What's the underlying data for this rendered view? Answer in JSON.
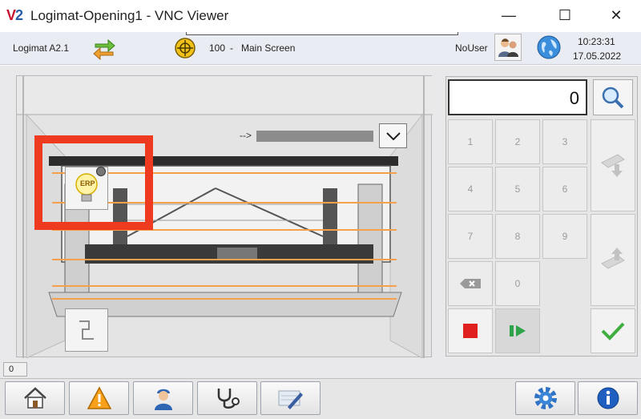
{
  "window": {
    "logo": "V2",
    "title": "Logimat-Opening1 - VNC Viewer",
    "minimize_glyph": "—",
    "maximize_glyph": "☐",
    "close_glyph": "✕"
  },
  "header": {
    "device": "Logimat A2.1",
    "screen_number": "100",
    "screen_separator": "-",
    "screen_name": "Main Screen",
    "user": "NoUser",
    "time": "10:23:31",
    "date": "17.05.2022"
  },
  "viz": {
    "arrow_label": "-->",
    "erp_label": "ERP",
    "accent_color": "#ee3a1f",
    "line_color": "#f5a04a"
  },
  "keypad": {
    "display_value": "0",
    "keys": [
      "1",
      "2",
      "3",
      "4",
      "5",
      "6",
      "7",
      "8",
      "9",
      "0"
    ]
  },
  "status": {
    "field_value": "0"
  },
  "icons": {
    "transfer": "transfer-arrows-icon",
    "screen": "target-icon",
    "user": "users-icon",
    "network": "globe-icon",
    "search": "magnifier-icon"
  }
}
